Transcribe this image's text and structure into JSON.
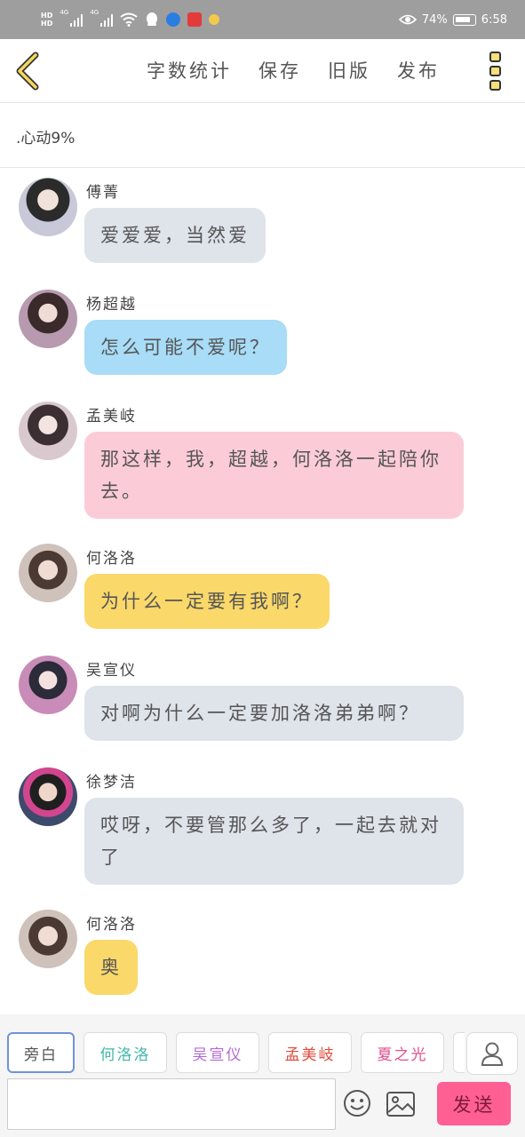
{
  "statusbar": {
    "battery": "74%",
    "time": "6:58",
    "network_a": "4G",
    "network_b": "4G",
    "hd_a": "HD",
    "hd_b": "HD"
  },
  "toolbar": {
    "word_count": "字数统计",
    "save": "保存",
    "old_version": "旧版",
    "publish": "发布"
  },
  "title": ".心动9%",
  "messages": [
    {
      "name": "傅菁",
      "text": "爱爱爱，当然爱",
      "bubble": "#dfe3ea",
      "avatar": "#c8c8d8"
    },
    {
      "name": "杨超越",
      "text": "怎么可能不爱呢？",
      "bubble": "#a8dcf7",
      "avatar": "#b79ab0"
    },
    {
      "name": "孟美岐",
      "text": "那这样，我，超越，何洛洛一起陪你去。",
      "bubble": "#fbccd8",
      "avatar": "#d9c9cf"
    },
    {
      "name": "何洛洛",
      "text": "为什么一定要有我啊？",
      "bubble": "#fad86a",
      "avatar": "#cfc2bb"
    },
    {
      "name": "吴宣仪",
      "text": "对啊为什么一定要加洛洛弟弟啊？",
      "bubble": "#dfe3ea",
      "avatar": "#c98bb7"
    },
    {
      "name": "徐梦洁",
      "text": "哎呀，不要管那么多了，一起去就对了",
      "bubble": "#dfe3ea",
      "avatar": "#3d4a6b"
    },
    {
      "name": "何洛洛",
      "text": "奥",
      "bubble": "#fad86a",
      "avatar": "#cfc2bb"
    }
  ],
  "characters": [
    {
      "label": "旁白",
      "color": "#555555"
    },
    {
      "label": "何洛洛",
      "color": "#3fb8a8"
    },
    {
      "label": "吴宣仪",
      "color": "#b46ad6"
    },
    {
      "label": "孟美岐",
      "color": "#e04a3a"
    },
    {
      "label": "夏之光",
      "color": "#e0508f"
    }
  ],
  "composer": {
    "send": "发送",
    "placeholder": ""
  },
  "icons": {
    "back": "chevron-left-icon",
    "more": "more-icon",
    "emoji": "smiley-icon",
    "picture": "image-icon",
    "user": "user-icon"
  }
}
